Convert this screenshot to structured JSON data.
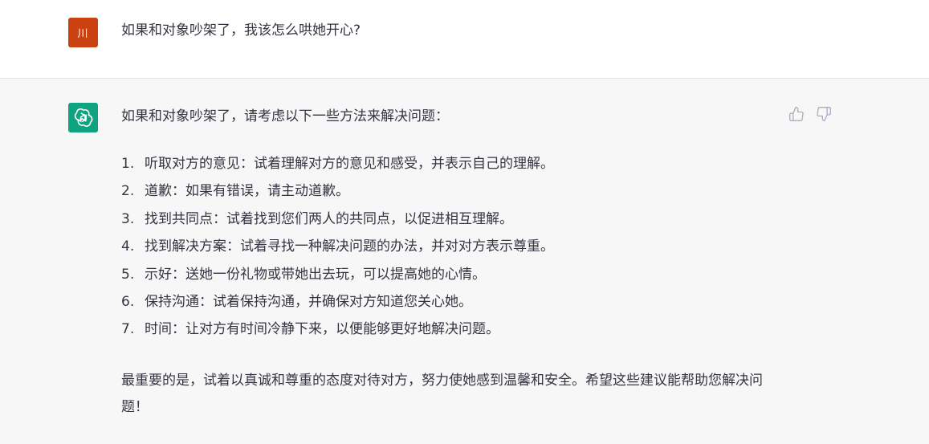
{
  "user": {
    "avatar_text": "川",
    "avatar_color": "#c9420f",
    "message": "如果和对象吵架了，我该怎么哄她开心?"
  },
  "assistant": {
    "avatar_icon": "openai-logo-icon",
    "avatar_color": "#10a37f",
    "intro": "如果和对象吵架了，请考虑以下一些方法来解决问题：",
    "items": [
      {
        "num": "1.",
        "text": "听取对方的意见：试着理解对方的意见和感受，并表示自己的理解。"
      },
      {
        "num": "2.",
        "text": "道歉：如果有错误，请主动道歉。"
      },
      {
        "num": "3.",
        "text": "找到共同点：试着找到您们两人的共同点，以促进相互理解。"
      },
      {
        "num": "4.",
        "text": "找到解决方案：试着寻找一种解决问题的办法，并对对方表示尊重。"
      },
      {
        "num": "5.",
        "text": "示好：送她一份礼物或带她出去玩，可以提高她的心情。"
      },
      {
        "num": "6.",
        "text": "保持沟通：试着保持沟通，并确保对方知道您关心她。"
      },
      {
        "num": "7.",
        "text": "时间：让对方有时间冷静下来，以便能够更好地解决问题。"
      }
    ],
    "conclusion": "最重要的是，试着以真诚和尊重的态度对待对方，努力使她感到温馨和安全。希望这些建议能帮助您解决问题！"
  },
  "feedback": {
    "thumbs_up_icon": "thumbs-up-icon",
    "thumbs_down_icon": "thumbs-down-icon"
  }
}
